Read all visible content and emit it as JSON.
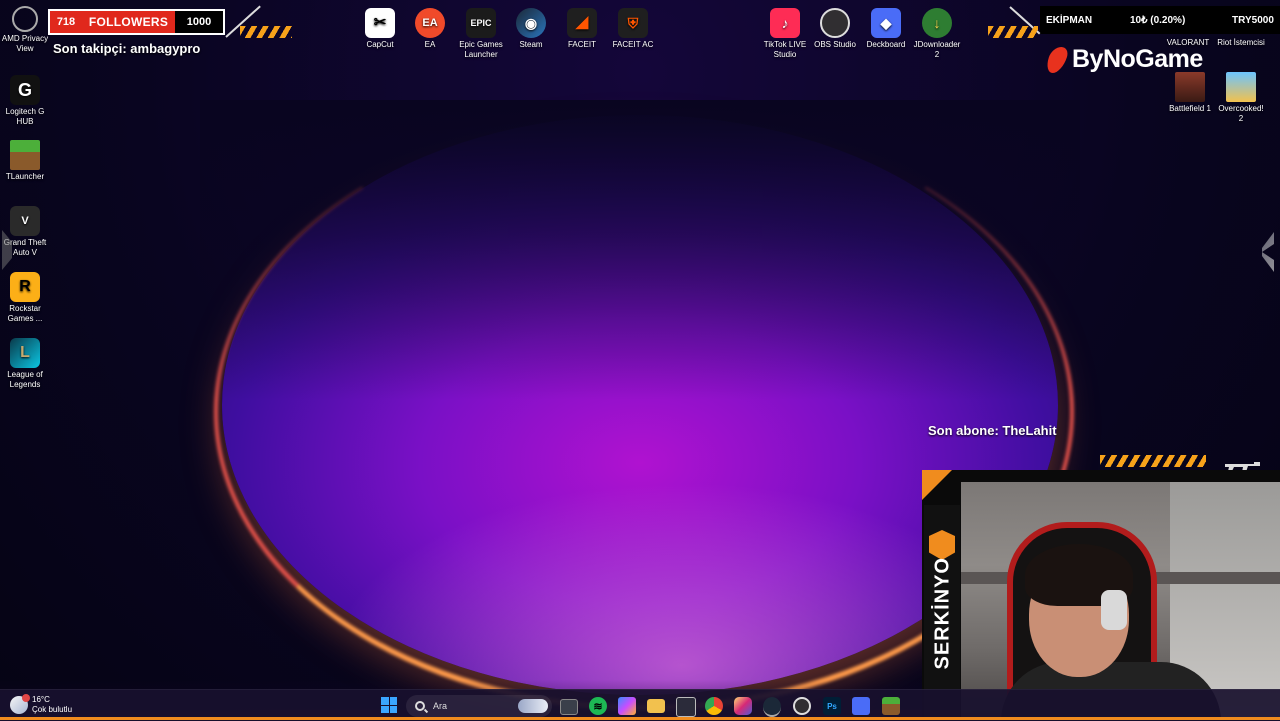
{
  "overlay": {
    "followers_count": "718",
    "followers_label": "FOLLOWERS",
    "followers_goal": "1000",
    "last_follower": "Son takipçi: ambagypro",
    "last_subscriber": "Son abone: TheLahit",
    "top_right": {
      "label": "EKİPMAN",
      "value": "10₺ (0.20%)",
      "goal": "TRY5000"
    },
    "logo_text": "ByNoGame",
    "streamer_name": "SERKİNYO"
  },
  "desktop_icons": {
    "left": [
      {
        "label": "AMD Privacy View",
        "icon": "amd-privacy-view-icon"
      },
      {
        "label": "Logitech G HUB",
        "icon": "logitech-g-hub-icon"
      },
      {
        "label": "TLauncher",
        "icon": "tlauncher-icon"
      },
      {
        "label": "Grand Theft Auto V",
        "icon": "gta-v-icon"
      },
      {
        "label": "Rockstar Games ...",
        "icon": "rockstar-games-icon"
      },
      {
        "label": "League of Legends",
        "icon": "league-of-legends-icon"
      }
    ],
    "top": [
      {
        "label": "CapCut",
        "icon": "capcut-icon"
      },
      {
        "label": "EA",
        "icon": "ea-icon"
      },
      {
        "label": "Epic Games Launcher",
        "icon": "epic-games-icon"
      },
      {
        "label": "Steam",
        "icon": "steam-icon"
      },
      {
        "label": "FACEIT",
        "icon": "faceit-icon"
      },
      {
        "label": "FACEIT AC",
        "icon": "faceit-ac-icon"
      },
      {
        "label": "TikTok LIVE Studio",
        "icon": "tiktok-live-icon"
      },
      {
        "label": "OBS Studio",
        "icon": "obs-studio-icon"
      },
      {
        "label": "Deckboard",
        "icon": "deckboard-icon"
      },
      {
        "label": "JDownloader 2",
        "icon": "jdownloader-icon"
      }
    ],
    "right": [
      {
        "label": "VALORANT",
        "icon": "valorant-icon"
      },
      {
        "label": "Riot İstemcisi",
        "icon": "riot-client-icon"
      },
      {
        "label": "Battlefield 1",
        "icon": "battlefield-1-icon"
      },
      {
        "label": "Overcooked! 2",
        "icon": "overcooked-2-icon"
      }
    ]
  },
  "taskbar": {
    "weather_temp": "16°C",
    "weather_desc": "Çok bulutlu",
    "search_placeholder": "Ara",
    "items": [
      "Dosya Gezgini",
      "Spotify",
      "Copilot",
      "Klasör",
      "Microsoft Store",
      "Chrome",
      "Instagram",
      "Steam",
      "OBS Studio",
      "Photoshop",
      "Deckboard",
      "TLauncher"
    ],
    "photoshop_label": "Ps"
  },
  "colors": {
    "accent_orange": "#f08c1e",
    "follower_red": "#e0281c",
    "start_blue": "#3aa6ff"
  }
}
